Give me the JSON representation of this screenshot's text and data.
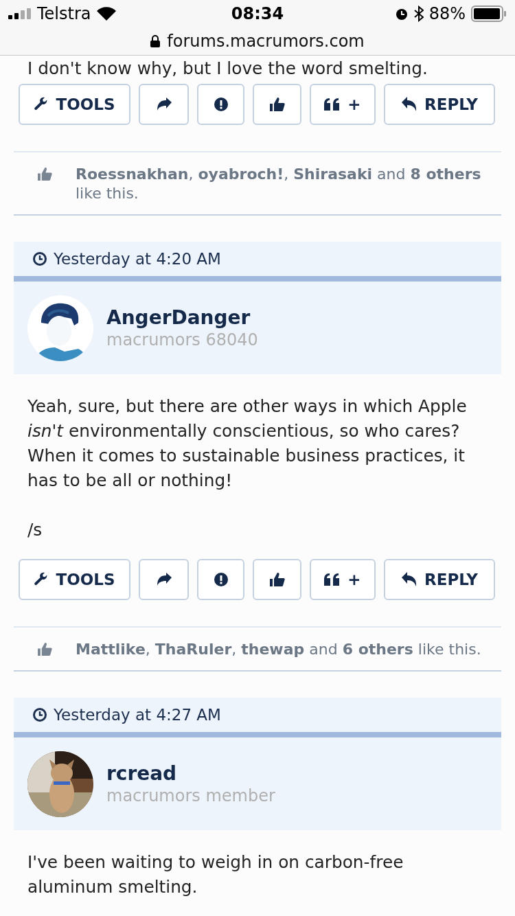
{
  "status_bar": {
    "carrier": "Telstra",
    "time": "08:34",
    "battery": "88%"
  },
  "address_bar": {
    "url": "forums.macrumors.com"
  },
  "posts": [
    {
      "message": [
        "I don't know why, but I love the word smelting."
      ],
      "actions": [
        {
          "kind": "tools",
          "label": "TOOLS"
        },
        {
          "kind": "share"
        },
        {
          "kind": "report"
        },
        {
          "kind": "like"
        },
        {
          "kind": "quote",
          "label": "+"
        },
        {
          "kind": "reply",
          "label": "REPLY"
        }
      ],
      "likes": "**Roessnakhan**, **oyabroch!**, **Shirasaki** and **8 others** like this."
    },
    {
      "date": "Yesterday at 4:20 AM",
      "author": "AngerDanger",
      "role": "macrumors 68040",
      "avatar": {
        "kind": "picture"
      },
      "message": [
        "Yeah, sure, but there are other ways in which Apple *isn't* environmentally conscientious, so who cares? When it comes to sustainable business practices, it has to be all or nothing!",
        "/s"
      ],
      "actions": [
        {
          "kind": "tools",
          "label": "TOOLS"
        },
        {
          "kind": "share"
        },
        {
          "kind": "report"
        },
        {
          "kind": "like"
        },
        {
          "kind": "quote",
          "label": "+"
        },
        {
          "kind": "reply",
          "label": "REPLY"
        }
      ],
      "likes": "**Mattlike**, **ThaRuler**, **thewap** and **6 others** like this."
    },
    {
      "date": "Yesterday at 4:27 AM",
      "author": "rcread",
      "role": "macrumors member",
      "avatar": {
        "kind": "picture"
      },
      "message": [
        "I've been waiting to weigh in on carbon-free aluminum smelting."
      ]
    }
  ]
}
